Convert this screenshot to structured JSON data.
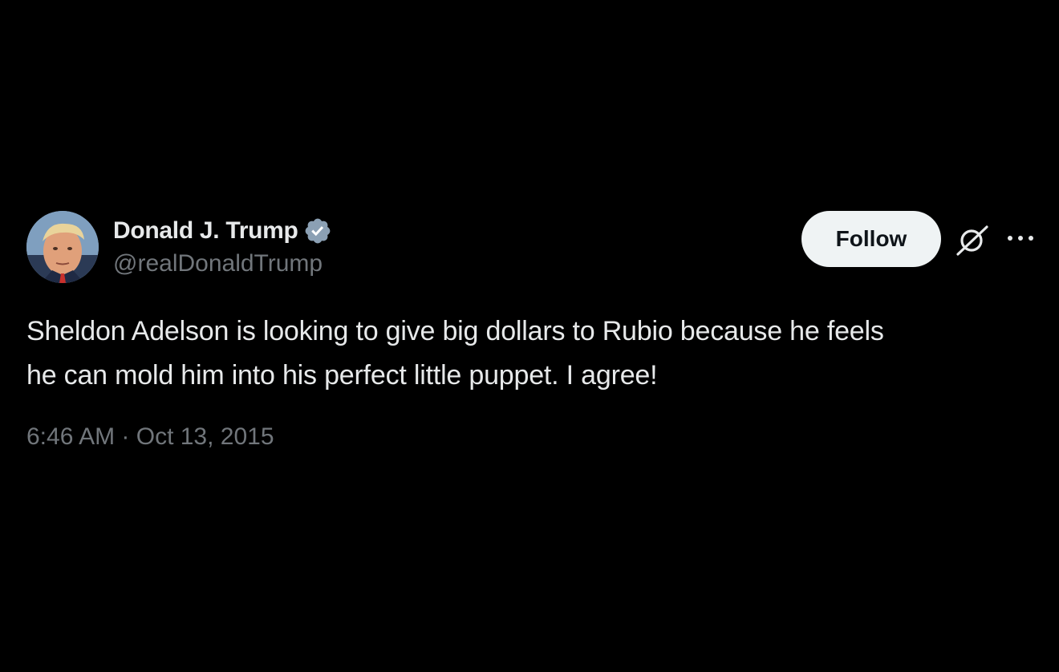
{
  "author": {
    "display_name": "Donald J. Trump",
    "handle": "@realDonaldTrump",
    "verified_icon": "verified-badge-icon",
    "avatar_icon": "profile-photo"
  },
  "actions": {
    "follow_label": "Follow",
    "grok_icon": "grok-icon",
    "more_icon": "more-options-icon"
  },
  "tweet": {
    "lines": [
      "Sheldon Adelson is looking to give big dollars to Rubio because he feels",
      "he can mold him into his perfect little puppet. I agree!"
    ],
    "timestamp": "6:46 AM · Oct 13, 2015"
  },
  "colors": {
    "background": "#000000",
    "primary_text": "#e7e9ea",
    "secondary_text": "#71767b",
    "follow_button_bg": "#eff3f4",
    "verified_blue": "#1d9bf0"
  }
}
